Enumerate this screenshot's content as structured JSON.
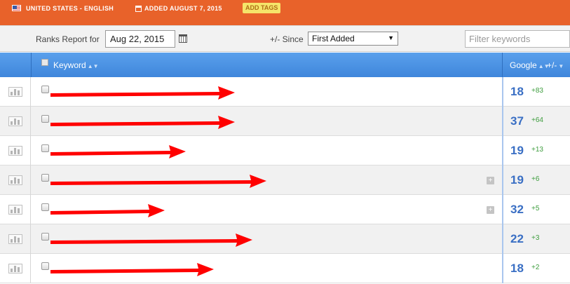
{
  "topbar": {
    "country": "UNITED STATES - ENGLISH",
    "added": "ADDED AUGUST 7, 2015",
    "add_tags": "ADD TAGS",
    "icons": [
      "us-flag-icon",
      "calendar-icon"
    ]
  },
  "toolbar": {
    "ranks_label": "Ranks Report for",
    "date_value": "Aug 22, 2015",
    "since_label": "+/- Since",
    "since_selected": "First Added",
    "filter_placeholder": "Filter keywords"
  },
  "table": {
    "headers": {
      "keyword": "Keyword",
      "google": "Google",
      "change": "+/-"
    },
    "rows": [
      {
        "keyword": "[redacted]",
        "rank": "18",
        "change": "+83",
        "has_plus": false
      },
      {
        "keyword": "[redacted]",
        "rank": "37",
        "change": "+64",
        "has_plus": false
      },
      {
        "keyword": "[redacted]",
        "rank": "19",
        "change": "+13",
        "has_plus": false
      },
      {
        "keyword": "[redacted]",
        "rank": "19",
        "change": "+6",
        "has_plus": true
      },
      {
        "keyword": "[redacted]",
        "rank": "32",
        "change": "+5",
        "has_plus": true
      },
      {
        "keyword": "[redacted]",
        "rank": "22",
        "change": "+3",
        "has_plus": false
      },
      {
        "keyword": "[redacted]",
        "rank": "18",
        "change": "+2",
        "has_plus": false
      }
    ]
  },
  "colors": {
    "topbar": "#e8622a",
    "header": "#4a90e2",
    "rank": "#3a6fc4",
    "change": "#3e9d3e",
    "redaction": "#ff0000"
  }
}
